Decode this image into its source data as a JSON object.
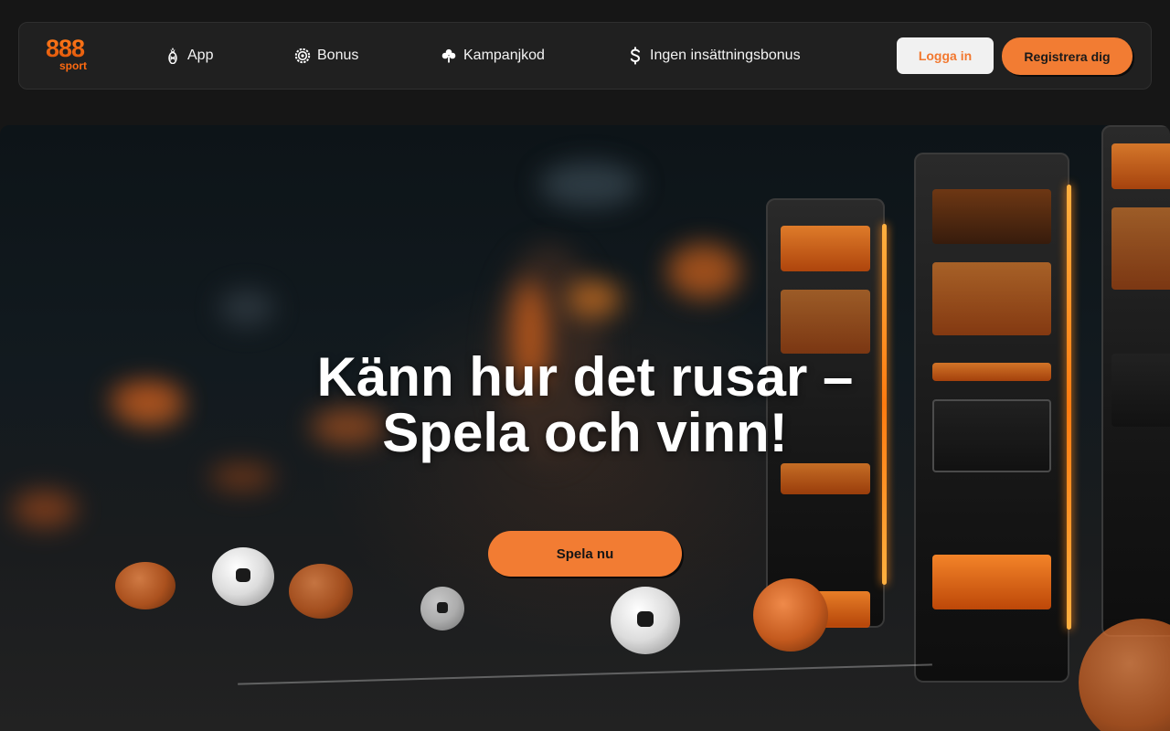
{
  "brand": {
    "logo_number": "888",
    "logo_sub": "sport",
    "accent_color": "#f27c33"
  },
  "nav": {
    "items": [
      {
        "label": "App",
        "icon": "pineapple-icon"
      },
      {
        "label": "Bonus",
        "icon": "gear-badge-icon"
      },
      {
        "label": "Kampanjkod",
        "icon": "clover-icon"
      },
      {
        "label": "Ingen insättningsbonus",
        "icon": "dollar-icon"
      }
    ]
  },
  "auth": {
    "login_label": "Logga in",
    "register_label": "Registrera dig"
  },
  "hero": {
    "title": "Känn hur det rusar – Spela och vinn!",
    "cta_label": "Spela nu"
  }
}
